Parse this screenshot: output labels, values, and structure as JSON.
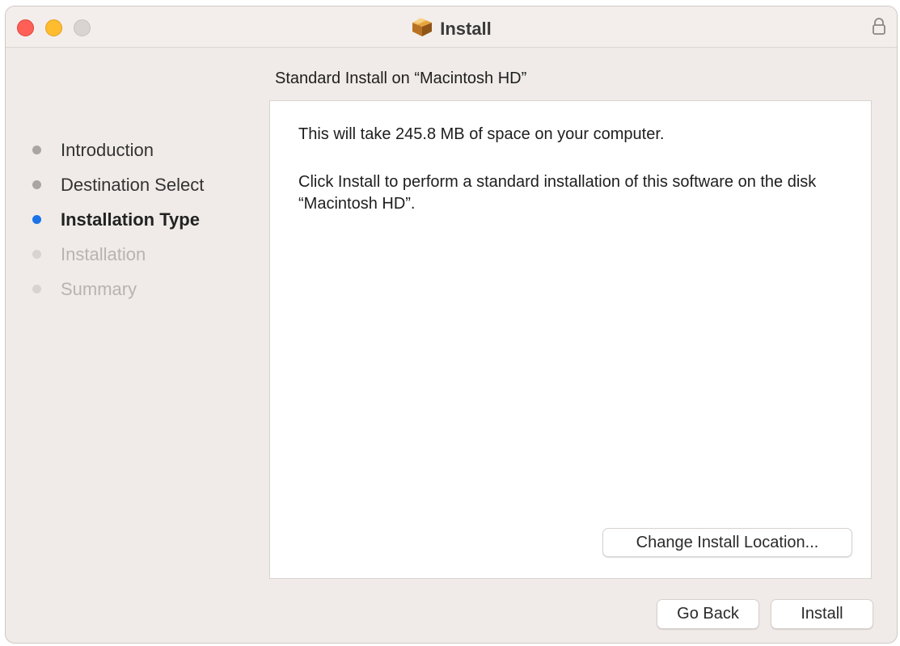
{
  "window": {
    "title": "Install",
    "title_icon": "package-box-icon",
    "lock_icon": "lock-icon"
  },
  "heading": "Standard Install on “Macintosh HD”",
  "steps": [
    {
      "label": "Introduction",
      "state": "done"
    },
    {
      "label": "Destination Select",
      "state": "done"
    },
    {
      "label": "Installation Type",
      "state": "current"
    },
    {
      "label": "Installation",
      "state": "future"
    },
    {
      "label": "Summary",
      "state": "future"
    }
  ],
  "content": {
    "space_text": "This will take 245.8 MB of space on your computer.",
    "install_text": "Click Install to perform a standard installation of this software on the disk “Macintosh HD”.",
    "change_location_label": "Change Install Location..."
  },
  "buttons": {
    "go_back": "Go Back",
    "install": "Install"
  },
  "colors": {
    "close": "#fe5f57",
    "minimize": "#febc2e",
    "zoom_disabled": "#d9d4d1",
    "current_step": "#1a73e8"
  }
}
